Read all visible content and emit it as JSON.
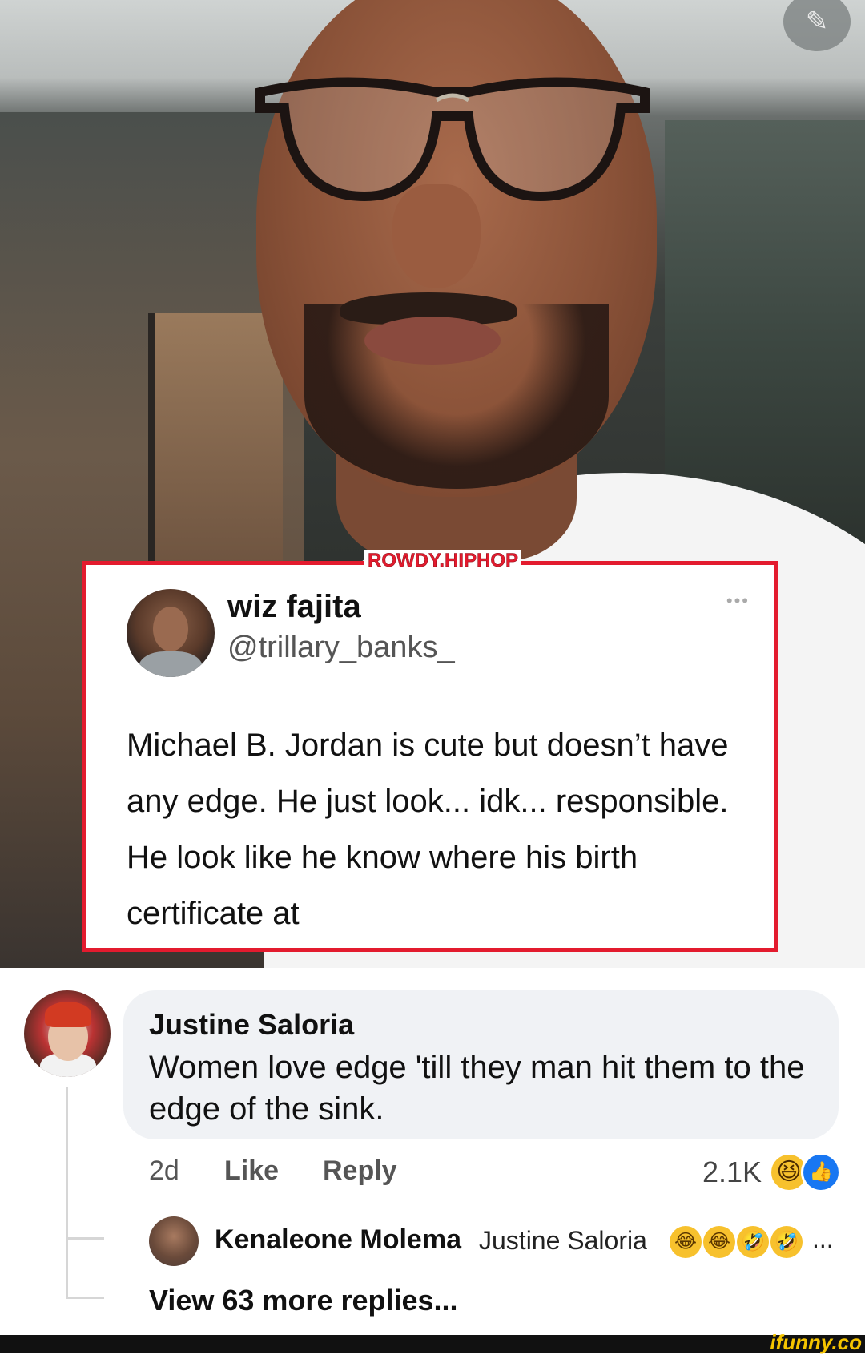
{
  "photo": {
    "edit_icon": "pencil-icon"
  },
  "tweet": {
    "watermark": "ROWDY.HIPHOP",
    "name": "wiz fajita",
    "handle": "@trillary_banks_",
    "more_icon": "•••",
    "text": "Michael B. Jordan is cute but doesn’t have any edge. He just look... idk... responsible. He look like he know where his birth certificate at",
    "border_color": "#e31b2e"
  },
  "comment": {
    "author": "Justine Saloria",
    "text": "Women love edge 'till they man hit them to the edge of the sink.",
    "age": "2d",
    "like_label": "Like",
    "reply_label": "Reply",
    "reaction_count": "2.1K",
    "reactions": [
      "haha-emoji",
      "like-emoji"
    ]
  },
  "reply": {
    "author": "Kenaleone Molema",
    "mention": "Justine Saloria",
    "emojis": [
      "tears-of-joy-emoji",
      "tears-of-joy-emoji",
      "rofl-emoji",
      "rofl-emoji"
    ],
    "ellipsis": "..."
  },
  "view_more": "View 63 more replies...",
  "footer": {
    "brand": "ifunny.co"
  }
}
